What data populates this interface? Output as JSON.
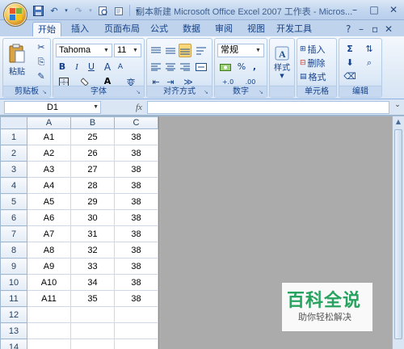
{
  "window": {
    "title": "副本新建 Microsoft Office Excel 2007 工作表 - Micros...",
    "controls": [
      "–",
      "□",
      "✕"
    ]
  },
  "quick_access": [
    "save-icon",
    "undo-icon",
    "redo-icon",
    "print-preview-icon",
    "customize-icon"
  ],
  "tabs": [
    {
      "label": "开始",
      "active": true
    },
    {
      "label": "插入"
    },
    {
      "label": "页面布局"
    },
    {
      "label": "公式"
    },
    {
      "label": "数据"
    },
    {
      "label": "审阅"
    },
    {
      "label": "视图"
    },
    {
      "label": "开发工具"
    }
  ],
  "tab_right": [
    "?",
    "–",
    "▫",
    "✕"
  ],
  "ribbon": {
    "clipboard": {
      "label": "剪贴板",
      "paste_label": "粘贴"
    },
    "font": {
      "label": "字体",
      "font_name": "Tahoma",
      "font_size": "11",
      "bold": "B",
      "italic": "I",
      "underline": "U",
      "grow": "A",
      "shrink": "A",
      "font_color": "A",
      "phonetic": "变"
    },
    "alignment": {
      "label": "对齐方式"
    },
    "number": {
      "label": "数字",
      "format": "常规",
      "percent": "%",
      "comma": ",",
      "inc_dec": "+.0",
      "dec_dec": ".00"
    },
    "styles": {
      "label": "样式"
    },
    "cells": {
      "label": "单元格",
      "insert": "插入",
      "delete": "删除",
      "format": "格式"
    },
    "editing": {
      "label": "编辑",
      "sum": "Σ"
    }
  },
  "formula_bar": {
    "name_box": "D1",
    "fx": "fx",
    "value": ""
  },
  "sheet": {
    "columns": [
      "A",
      "B",
      "C"
    ],
    "rows": [
      {
        "n": "1",
        "cells": [
          "A1",
          "25",
          "38"
        ]
      },
      {
        "n": "2",
        "cells": [
          "A2",
          "26",
          "38"
        ]
      },
      {
        "n": "3",
        "cells": [
          "A3",
          "27",
          "38"
        ]
      },
      {
        "n": "4",
        "cells": [
          "A4",
          "28",
          "38"
        ]
      },
      {
        "n": "5",
        "cells": [
          "A5",
          "29",
          "38"
        ]
      },
      {
        "n": "6",
        "cells": [
          "A6",
          "30",
          "38"
        ]
      },
      {
        "n": "7",
        "cells": [
          "A7",
          "31",
          "38"
        ]
      },
      {
        "n": "8",
        "cells": [
          "A8",
          "32",
          "38"
        ]
      },
      {
        "n": "9",
        "cells": [
          "A9",
          "33",
          "38"
        ]
      },
      {
        "n": "10",
        "cells": [
          "A10",
          "34",
          "38"
        ]
      },
      {
        "n": "11",
        "cells": [
          "A11",
          "35",
          "38"
        ]
      },
      {
        "n": "12",
        "cells": [
          "",
          "",
          ""
        ]
      },
      {
        "n": "13",
        "cells": [
          "",
          "",
          ""
        ]
      },
      {
        "n": "14",
        "cells": [
          "",
          "",
          ""
        ]
      }
    ]
  },
  "watermark": {
    "title": "百科全说",
    "subtitle": "助你轻松解决"
  },
  "colors": {
    "accent": "#15428b",
    "watermark_green": "#27a25f"
  }
}
